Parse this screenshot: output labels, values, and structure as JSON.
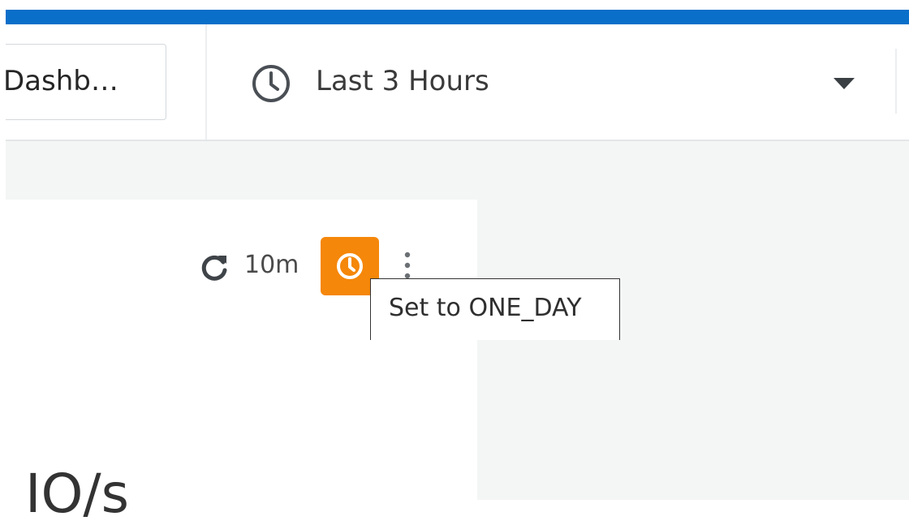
{
  "toolbar": {
    "dashboard_button_label": "Dashb…",
    "time_range_label": "Last 3 Hours",
    "time_icon": "clock-icon",
    "dropdown_icon": "caret-down-icon"
  },
  "widget": {
    "refresh_icon": "refresh-icon",
    "refresh_interval": "10m",
    "time_override_icon": "clock-icon",
    "menu_icon": "kebab-icon",
    "tooltip": "Set to ONE_DAY",
    "title": "IO/s"
  },
  "colors": {
    "header_blue": "#0a6fc9",
    "override_orange": "#f5870a",
    "canvas_gray": "#f4f5f5"
  }
}
